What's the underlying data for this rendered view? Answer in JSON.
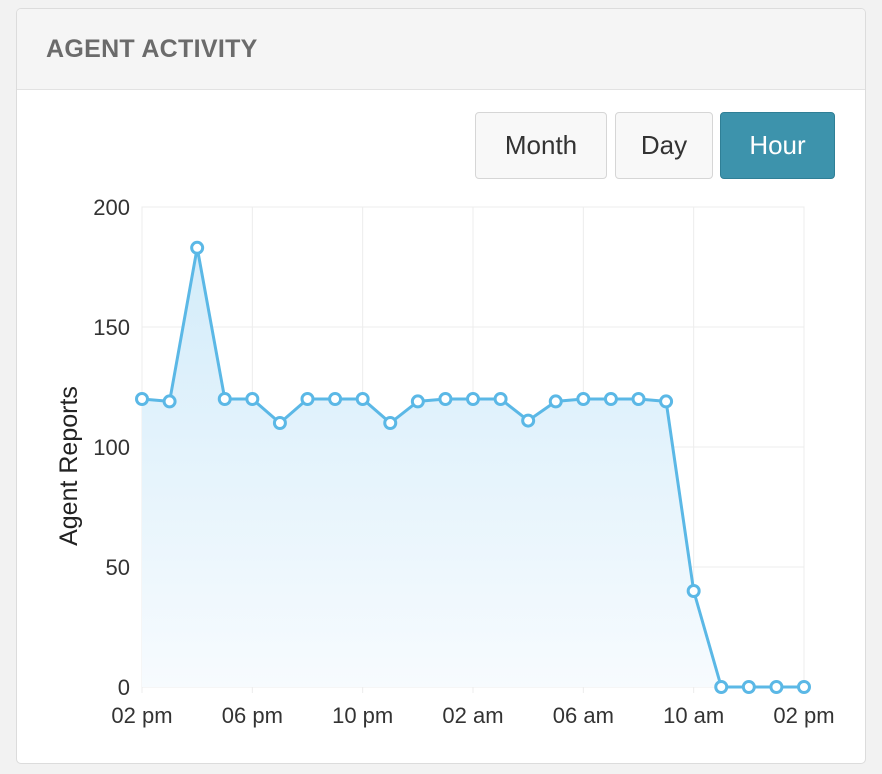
{
  "panel": {
    "title": "AGENT ACTIVITY"
  },
  "range_buttons": {
    "month_label": "Month",
    "day_label": "Day",
    "hour_label": "Hour",
    "selected": "Hour"
  },
  "colors": {
    "line": "#5bb8e6",
    "area_top": "#d3ecfa",
    "area_bottom": "#f7fbfe",
    "active_button": "#3d93ac"
  },
  "chart_data": {
    "type": "area",
    "title": "",
    "xlabel": "",
    "ylabel": "Agent Reports",
    "ylim": [
      0,
      200
    ],
    "yticks": [
      "0",
      "50",
      "100",
      "150",
      "200"
    ],
    "xticks": [
      "02 pm",
      "06 pm",
      "10 pm",
      "02 am",
      "06 am",
      "10 am",
      "02 pm"
    ],
    "grid": true,
    "series": [
      {
        "values": [
          120,
          119,
          183,
          120,
          120,
          110,
          120,
          120,
          120,
          110,
          119,
          120,
          120,
          120,
          111,
          119,
          120,
          120,
          120,
          119,
          40,
          0,
          0,
          0,
          0
        ]
      }
    ]
  }
}
